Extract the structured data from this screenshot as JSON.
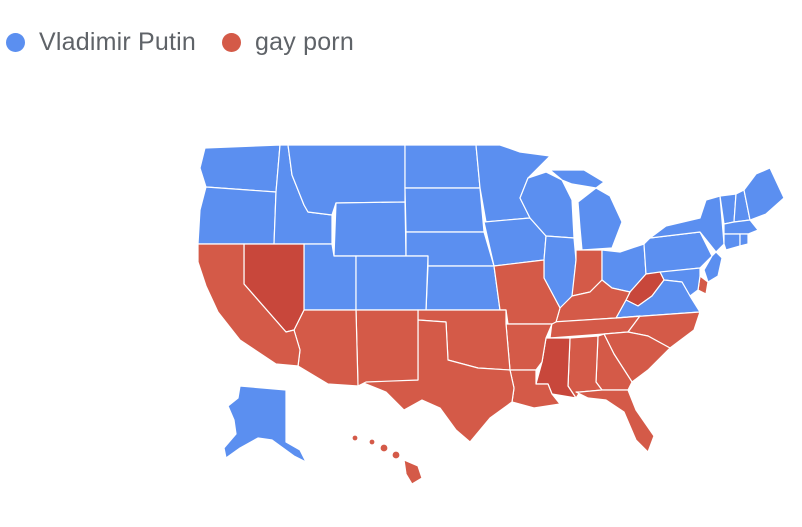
{
  "legend": {
    "items": [
      {
        "label": "Vladimir Putin",
        "color": "#5b8ff0"
      },
      {
        "label": "gay porn",
        "color": "#d45a48"
      }
    ]
  },
  "map": {
    "colors": {
      "putin": "#5b8ff0",
      "gay_porn": "#d45a48",
      "gay_porn_dark": "#c8473b"
    },
    "states": {
      "WA": "putin",
      "OR": "putin",
      "ID": "putin",
      "MT": "putin",
      "WY": "putin",
      "ND": "putin",
      "SD": "putin",
      "NE": "putin",
      "KS": "putin",
      "MN": "putin",
      "IA": "putin",
      "WI": "putin",
      "IL": "putin",
      "MI": "putin",
      "OH": "putin",
      "PA": "putin",
      "NY": "putin",
      "VT": "putin",
      "NH": "putin",
      "ME": "putin",
      "MA": "putin",
      "CT": "putin",
      "RI": "putin",
      "NJ": "putin",
      "MD": "putin",
      "VA": "putin",
      "UT": "putin",
      "CO": "putin",
      "AK": "putin",
      "CA": "gay_porn",
      "NV": "gay_porn_dark",
      "AZ": "gay_porn",
      "NM": "gay_porn",
      "TX": "gay_porn",
      "OK": "gay_porn",
      "MO": "gay_porn",
      "AR": "gay_porn",
      "LA": "gay_porn",
      "MS": "gay_porn_dark",
      "AL": "gay_porn",
      "GA": "gay_porn",
      "FL": "gay_porn",
      "SC": "gay_porn",
      "NC": "gay_porn",
      "TN": "gay_porn",
      "KY": "gay_porn",
      "IN": "gay_porn",
      "WV": "gay_porn_dark",
      "DE": "gay_porn",
      "HI": "gay_porn"
    }
  }
}
